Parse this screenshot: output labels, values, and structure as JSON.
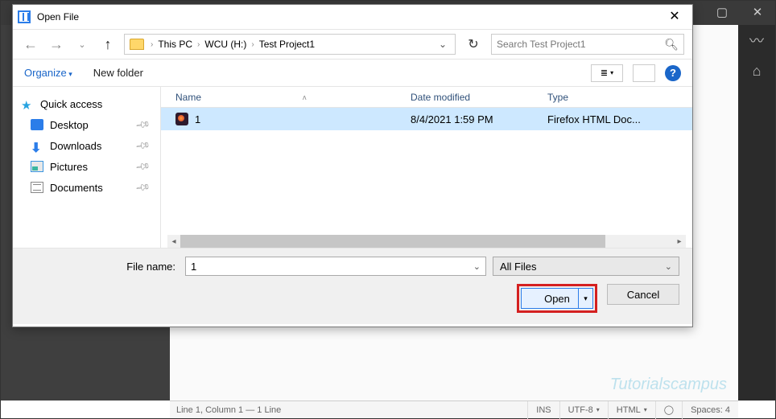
{
  "editor": {
    "status_left": "Line 1, Column 1 — 1 Line",
    "status_ins": "INS",
    "status_enc": "UTF-8",
    "status_lang": "HTML",
    "status_spaces": "Spaces:  4"
  },
  "watermark": "Tutorialscampus",
  "dialog": {
    "title": "Open File",
    "breadcrumb": [
      "This PC",
      "WCU (H:)",
      "Test Project1"
    ],
    "search_placeholder": "Search Test Project1",
    "organize": "Organize",
    "new_folder": "New folder",
    "columns": {
      "name": "Name",
      "modified": "Date modified",
      "type": "Type"
    },
    "tree": {
      "quick_access": "Quick access",
      "desktop": "Desktop",
      "downloads": "Downloads",
      "pictures": "Pictures",
      "documents": "Documents"
    },
    "files": [
      {
        "name": "1",
        "modified": "8/4/2021 1:59 PM",
        "type": "Firefox HTML Doc..."
      }
    ],
    "filename_label": "File name:",
    "filename_value": "1",
    "filter": "All Files",
    "open": "Open",
    "cancel": "Cancel"
  }
}
